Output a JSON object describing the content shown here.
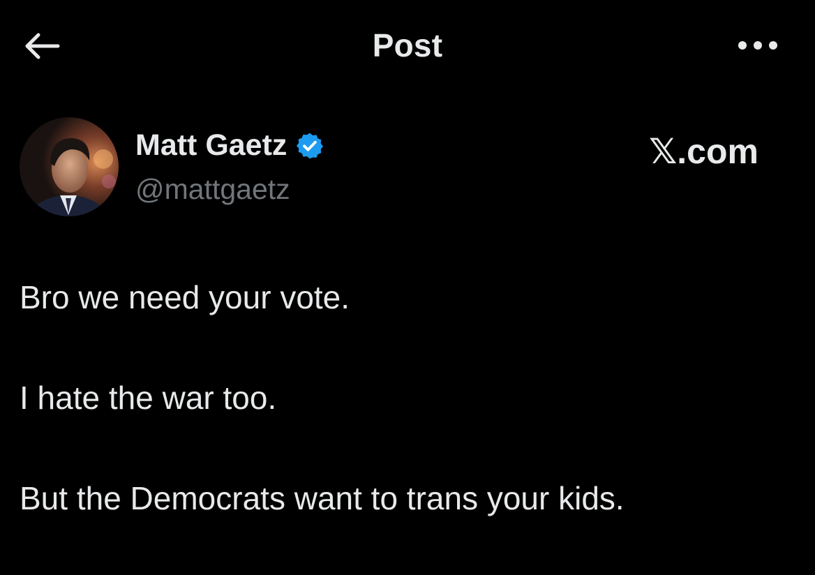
{
  "header": {
    "title": "Post",
    "back_icon": "arrow-left-icon",
    "more_icon": "ellipsis-icon"
  },
  "author": {
    "display_name": "Matt Gaetz",
    "handle": "@mattgaetz",
    "verified_icon": "verified-badge-icon",
    "verified_color": "#1d9bf0"
  },
  "watermark": {
    "text": "𝕏.com"
  },
  "post": {
    "lines": [
      "Bro we need your vote.",
      "I hate the war too.",
      "But the Democrats want to trans your kids."
    ]
  },
  "colors": {
    "background": "#000000",
    "text_primary": "#e7e9ea",
    "text_secondary": "#71767b",
    "accent": "#1d9bf0"
  }
}
